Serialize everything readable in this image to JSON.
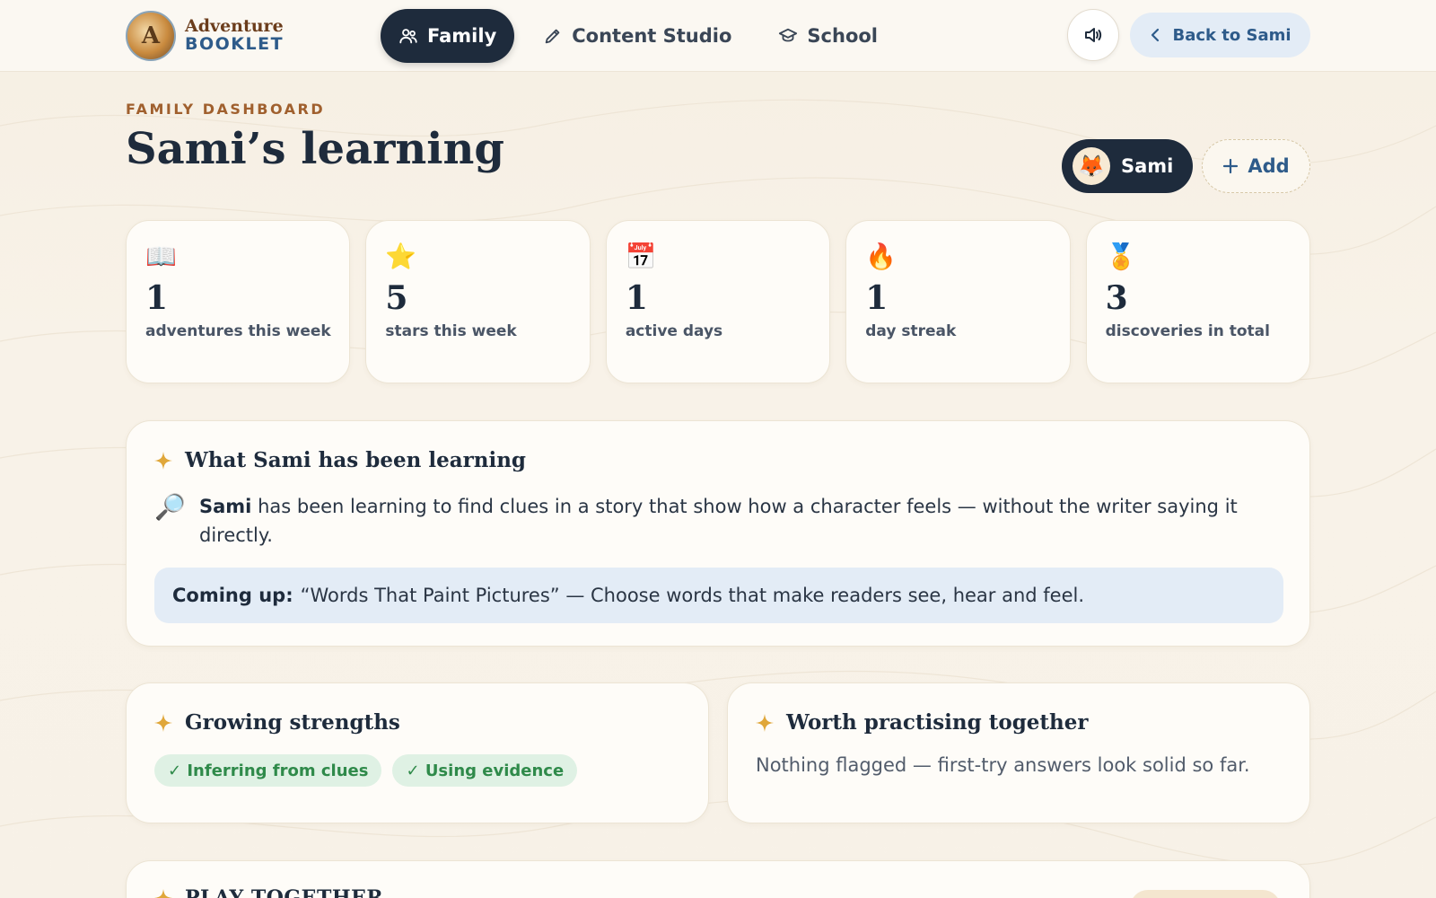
{
  "brand": {
    "line1": "Adventure",
    "line2": "BOOKLET",
    "badge_letter": "A"
  },
  "nav": {
    "items": [
      {
        "label": "Family",
        "icon": "people-icon",
        "active": true
      },
      {
        "label": "Content Studio",
        "icon": "pencil-icon",
        "active": false
      },
      {
        "label": "School",
        "icon": "graduation-cap-icon",
        "active": false
      }
    ]
  },
  "header_actions": {
    "sound_icon": "speaker-icon",
    "back_label": "Back to Sami"
  },
  "page": {
    "eyebrow": "FAMILY DASHBOARD",
    "title": "Sami’s learning"
  },
  "child": {
    "name": "Sami",
    "avatar": "🦊",
    "add_label": "Add"
  },
  "stats": [
    {
      "icon": "📖",
      "value": "1",
      "label": "adventures this week"
    },
    {
      "icon": "⭐",
      "value": "5",
      "label": "stars this week"
    },
    {
      "icon": "📅",
      "value": "1",
      "label": "active days"
    },
    {
      "icon": "🔥",
      "value": "1",
      "label": "day streak"
    },
    {
      "icon": "🏅",
      "value": "3",
      "label": "discoveries in total"
    }
  ],
  "learning": {
    "title": "What Sami has been learning",
    "icon": "🔎",
    "name": "Sami",
    "summary": "has been learning to find clues in a story that show how a character feels — without the writer saying it directly.",
    "coming_label": "Coming up:",
    "coming_text": "“Words That Paint Pictures” — Choose words that make readers see, hear and feel."
  },
  "strengths": {
    "title": "Growing strengths",
    "tags": [
      "✓ Inferring from clues",
      "✓ Using evidence"
    ]
  },
  "practice": {
    "title": "Worth practising together",
    "text": "Nothing flagged — first-try answers look solid so far."
  },
  "play": {
    "title": "PLAY TOGETHER"
  },
  "colors": {
    "navy": "#1e2b3c",
    "accent_blue": "#2e5b8a",
    "eyebrow_brown": "#a0602e",
    "sparkle_gold": "#e0a73a",
    "success_green": "#2f8a4a",
    "info_bg": "#e3ecf6"
  }
}
